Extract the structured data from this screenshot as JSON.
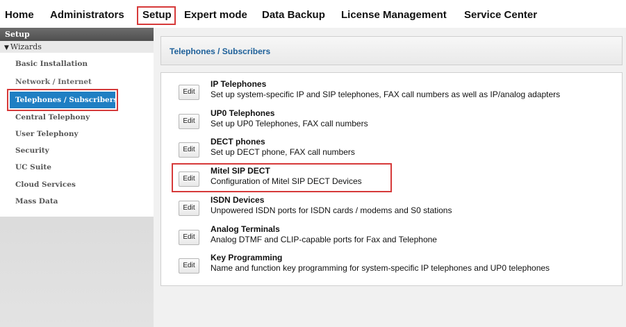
{
  "topnav": {
    "items": [
      {
        "label": "Home"
      },
      {
        "label": "Administrators"
      },
      {
        "label": "Setup",
        "highlighted": true
      },
      {
        "label": "Expert mode"
      },
      {
        "label": "Data Backup"
      },
      {
        "label": "License Management"
      },
      {
        "label": "Service Center"
      }
    ]
  },
  "sidebar": {
    "header": "Setup",
    "group": "Wizards",
    "items": [
      {
        "label": "Basic Installation"
      },
      {
        "label": "Network / Internet"
      },
      {
        "label": "Telephones / Subscribers",
        "active": true
      },
      {
        "label": "Central Telephony"
      },
      {
        "label": "User Telephony"
      },
      {
        "label": "Security"
      },
      {
        "label": "UC Suite"
      },
      {
        "label": "Cloud Services"
      },
      {
        "label": "Mass Data"
      }
    ]
  },
  "main": {
    "title": "Telephones / Subscribers",
    "rows": [
      {
        "edit": "Edit",
        "title": "IP Telephones",
        "desc": "Set up system-specific IP and SIP telephones, FAX call numbers as well as IP/analog adapters"
      },
      {
        "edit": "Edit",
        "title": "UP0 Telephones",
        "desc": "Set up UP0 Telephones, FAX call numbers"
      },
      {
        "edit": "Edit",
        "title": "DECT phones",
        "desc": "Set up DECT phone, FAX call numbers"
      },
      {
        "edit": "Edit",
        "title": "Mitel SIP DECT",
        "desc": "Configuration of Mitel SIP DECT Devices",
        "highlighted": true
      },
      {
        "edit": "Edit",
        "title": "ISDN Devices",
        "desc": "Unpowered ISDN ports for ISDN cards / modems and S0 stations"
      },
      {
        "edit": "Edit",
        "title": "Analog Terminals",
        "desc": "Analog DTMF and CLIP-capable ports for Fax and Telephone"
      },
      {
        "edit": "Edit",
        "title": "Key Programming",
        "desc": "Name and function key programming for system-specific IP telephones and UP0 telephones"
      }
    ]
  },
  "colors": {
    "accent_blue": "#1f7fc3",
    "title_blue": "#1c5f99",
    "highlight_red": "#d63a3a"
  }
}
